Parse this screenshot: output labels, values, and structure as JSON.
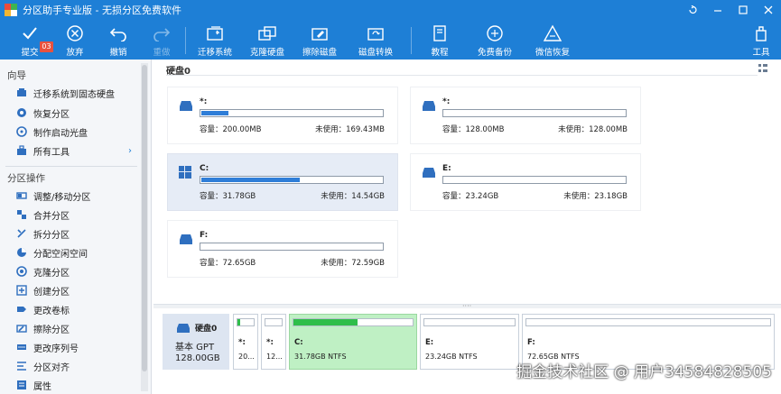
{
  "window": {
    "title": "分区助手专业版 - 无损分区免费软件",
    "controls": [
      "restore-icon",
      "minimize-icon",
      "maximize-icon",
      "close-icon"
    ]
  },
  "toolbar": {
    "badge": "03",
    "items": [
      {
        "label": "提交",
        "icon": "check-icon",
        "enabled": true
      },
      {
        "label": "放弃",
        "icon": "cancel-icon",
        "enabled": true
      },
      {
        "label": "撤销",
        "icon": "undo-icon",
        "enabled": true
      },
      {
        "label": "重做",
        "icon": "redo-icon",
        "enabled": false
      },
      {
        "label": "迁移系统",
        "icon": "migrate-os-icon",
        "enabled": true
      },
      {
        "label": "克隆硬盘",
        "icon": "clone-disk-icon",
        "enabled": true
      },
      {
        "label": "擦除磁盘",
        "icon": "wipe-disk-icon",
        "enabled": true
      },
      {
        "label": "磁盘转换",
        "icon": "disk-convert-icon",
        "enabled": true
      },
      {
        "label": "教程",
        "icon": "tutorial-icon",
        "enabled": true
      },
      {
        "label": "免费备份",
        "icon": "backup-icon",
        "enabled": true
      },
      {
        "label": "微信恢复",
        "icon": "recover-icon",
        "enabled": true
      },
      {
        "label": "工具",
        "icon": "tools-icon",
        "enabled": true
      }
    ]
  },
  "sidebar": {
    "wizard_title": "向导",
    "wizard_items": [
      {
        "label": "迁移系统到固态硬盘",
        "icon": "migrate-icon"
      },
      {
        "label": "恢复分区",
        "icon": "restore-partition-icon"
      },
      {
        "label": "制作启动光盘",
        "icon": "bootable-media-icon"
      },
      {
        "label": "所有工具",
        "icon": "all-tools-icon"
      }
    ],
    "ops_title": "分区操作",
    "ops_items": [
      {
        "label": "调整/移动分区",
        "icon": "resize-icon"
      },
      {
        "label": "合并分区",
        "icon": "merge-icon"
      },
      {
        "label": "拆分分区",
        "icon": "split-icon"
      },
      {
        "label": "分配空闲空间",
        "icon": "allocate-icon"
      },
      {
        "label": "克隆分区",
        "icon": "clone-partition-icon"
      },
      {
        "label": "创建分区",
        "icon": "create-icon"
      },
      {
        "label": "更改卷标",
        "icon": "label-icon"
      },
      {
        "label": "擦除分区",
        "icon": "wipe-partition-icon"
      },
      {
        "label": "更改序列号",
        "icon": "serial-icon"
      },
      {
        "label": "分区对齐",
        "icon": "align-icon"
      },
      {
        "label": "属性",
        "icon": "properties-icon"
      }
    ]
  },
  "main": {
    "header": "硬盘0",
    "partitions": [
      {
        "name": "*:",
        "icon": "drive-icon",
        "capacity": "容量：200.00MB",
        "free": "未使用：169.43MB",
        "used_fraction": 0.15,
        "selected": false
      },
      {
        "name": "*:",
        "icon": "drive-icon",
        "capacity": "容量：128.00MB",
        "free": "未使用：128.00MB",
        "used_fraction": 0.0,
        "selected": false
      },
      {
        "name": "C:",
        "icon": "windows-icon",
        "capacity": "容量：31.78GB",
        "free": "未使用：14.54GB",
        "used_fraction": 0.54,
        "selected": true
      },
      {
        "name": "E:",
        "icon": "drive-icon",
        "capacity": "容量：23.24GB",
        "free": "未使用：23.18GB",
        "used_fraction": 0.0,
        "selected": false
      },
      {
        "name": "F:",
        "icon": "drive-icon",
        "capacity": "容量：72.65GB",
        "free": "未使用：72.59GB",
        "used_fraction": 0.0,
        "selected": false
      }
    ]
  },
  "diskmap": {
    "disk_name": "硬盘0",
    "disk_type": "基本 GPT",
    "disk_size": "128.00GB",
    "parts": [
      {
        "label": "*:",
        "sub": "20...",
        "used_fraction": 0.15,
        "selected": false
      },
      {
        "label": "*:",
        "sub": "12...",
        "used_fraction": 0.0,
        "selected": false
      },
      {
        "label": "C:",
        "sub": "31.78GB NTFS",
        "used_fraction": 0.54,
        "selected": true
      },
      {
        "label": "E:",
        "sub": "23.24GB NTFS",
        "used_fraction": 0.0,
        "selected": false
      },
      {
        "label": "F:",
        "sub": "72.65GB NTFS",
        "used_fraction": 0.0,
        "selected": false
      }
    ]
  },
  "watermark": "掘金技术社区 @ 用户34584828505",
  "colors": {
    "accent": "#1e7fd6",
    "used": "#2f7ed8",
    "selected_green": "#bff0c4",
    "bar_green": "#2fbe4a"
  }
}
